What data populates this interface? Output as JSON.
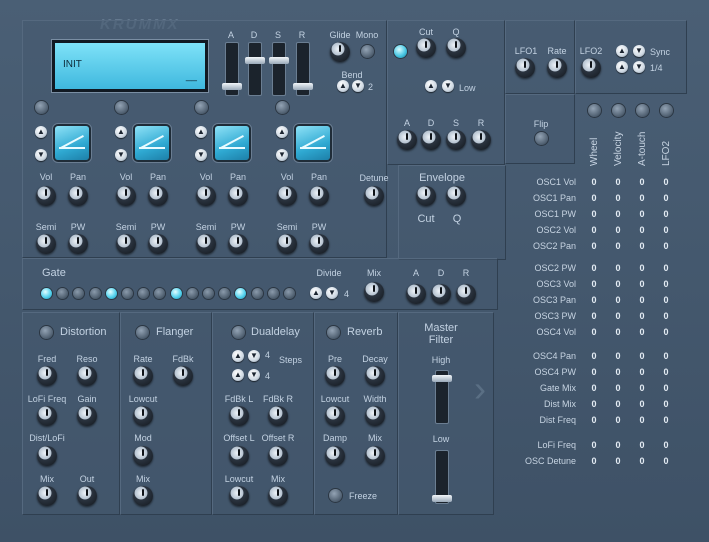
{
  "brand": "KRUMMX",
  "lcd": {
    "name": "INIT",
    "sub": "__"
  },
  "adsr_labels": [
    "A",
    "D",
    "S",
    "R"
  ],
  "glide": "Glide",
  "mono": "Mono",
  "bend": "Bend",
  "bend_val": "2",
  "filter": {
    "cut": "Cut",
    "q": "Q",
    "mode": "Low",
    "adsr": [
      "A",
      "D",
      "S",
      "R"
    ]
  },
  "lfo": {
    "lfo1": "LFO1",
    "rate": "Rate",
    "lfo2": "LFO2",
    "sync": "Sync",
    "div": "1/4"
  },
  "flip": "Flip",
  "osc": {
    "vol": "Vol",
    "pan": "Pan",
    "semi": "Semi",
    "pw": "PW"
  },
  "detune": "Detune",
  "envelope": {
    "title": "Envelope",
    "cut": "Cut",
    "q": "Q"
  },
  "gate": {
    "title": "Gate",
    "divide": "Divide",
    "divide_val": "4",
    "mix": "Mix",
    "a": "A",
    "d": "D",
    "r": "R",
    "steps": [
      1,
      0,
      0,
      0,
      1,
      0,
      0,
      0,
      1,
      0,
      0,
      0,
      1,
      0,
      0,
      0
    ]
  },
  "fx": {
    "distortion": {
      "title": "Distortion",
      "fred": "Fred",
      "reso": "Reso",
      "lofi_freq": "LoFi Freq",
      "gain": "Gain",
      "dist_lofi": "Dist/LoFi",
      "mix": "Mix",
      "out": "Out"
    },
    "flanger": {
      "title": "Flanger",
      "rate": "Rate",
      "fdbk": "FdBk",
      "lowcut": "Lowcut",
      "mod": "Mod",
      "mix": "Mix"
    },
    "dualdelay": {
      "title": "Dualdelay",
      "steps": "Steps",
      "steps_a": "4",
      "steps_b": "4",
      "fdbk_l": "FdBk L",
      "fdbk_r": "FdBk R",
      "offset_l": "Offset L",
      "offset_r": "Offset R",
      "lowcut": "Lowcut",
      "mix": "Mix"
    },
    "reverb": {
      "title": "Reverb",
      "pre": "Pre",
      "decay": "Decay",
      "lowcut": "Lowcut",
      "width": "Width",
      "damp": "Damp",
      "mix": "Mix",
      "freeze": "Freeze"
    },
    "master": {
      "title1": "Master",
      "title2": "Filter",
      "high": "High",
      "low": "Low"
    }
  },
  "mod_matrix": {
    "columns": [
      "Wheel",
      "Velocity",
      "A-touch",
      "LFO2"
    ],
    "rows": [
      {
        "label": "OSC1 Vol",
        "vals": [
          "0",
          "0",
          "0",
          "0"
        ]
      },
      {
        "label": "OSC1 Pan",
        "vals": [
          "0",
          "0",
          "0",
          "0"
        ]
      },
      {
        "label": "OSC1 PW",
        "vals": [
          "0",
          "0",
          "0",
          "0"
        ]
      },
      {
        "label": "OSC2 Vol",
        "vals": [
          "0",
          "0",
          "0",
          "0"
        ]
      },
      {
        "label": "OSC2 Pan",
        "vals": [
          "0",
          "0",
          "0",
          "0"
        ]
      },
      {
        "label": "OSC2 PW",
        "vals": [
          "0",
          "0",
          "0",
          "0"
        ]
      },
      {
        "label": "OSC3 Vol",
        "vals": [
          "0",
          "0",
          "0",
          "0"
        ]
      },
      {
        "label": "OSC3 Pan",
        "vals": [
          "0",
          "0",
          "0",
          "0"
        ]
      },
      {
        "label": "OSC3 PW",
        "vals": [
          "0",
          "0",
          "0",
          "0"
        ]
      },
      {
        "label": "OSC4 Vol",
        "vals": [
          "0",
          "0",
          "0",
          "0"
        ]
      },
      {
        "label": "OSC4 Pan",
        "vals": [
          "0",
          "0",
          "0",
          "0"
        ]
      },
      {
        "label": "OSC4 PW",
        "vals": [
          "0",
          "0",
          "0",
          "0"
        ]
      },
      {
        "label": "Gate Mix",
        "vals": [
          "0",
          "0",
          "0",
          "0"
        ]
      },
      {
        "label": "Dist Mix",
        "vals": [
          "0",
          "0",
          "0",
          "0"
        ]
      },
      {
        "label": "Dist Freq",
        "vals": [
          "0",
          "0",
          "0",
          "0"
        ]
      },
      {
        "label": "LoFi Freq",
        "vals": [
          "0",
          "0",
          "0",
          "0"
        ]
      },
      {
        "label": "OSC Detune",
        "vals": [
          "0",
          "0",
          "0",
          "0"
        ]
      }
    ]
  }
}
